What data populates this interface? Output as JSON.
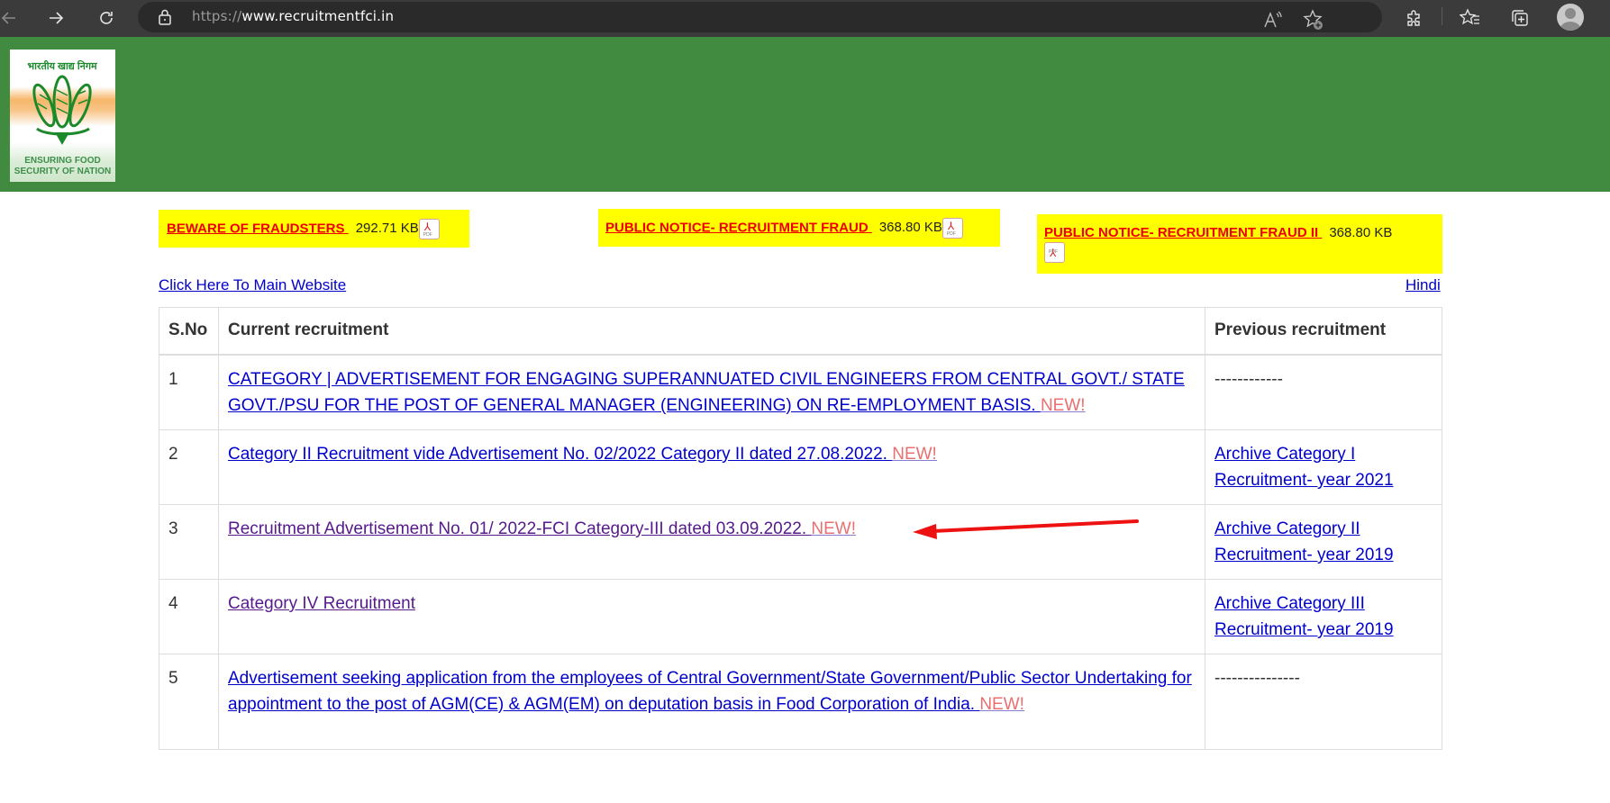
{
  "browser": {
    "url_scheme": "https://",
    "url_host": "www.recruitmentfci.in",
    "icons": [
      "back-icon",
      "forward-icon",
      "reload-icon",
      "lock-icon",
      "read-aloud-icon",
      "add-favorite-icon",
      "extensions-icon",
      "favorites-icon",
      "collections-icon",
      "profile-avatar"
    ]
  },
  "header": {
    "logo_caption_line1": "ENSURING FOOD",
    "logo_caption_line2": "SECURITY OF NATION",
    "logo_hindi": "भारतीय खाद्य निगम",
    "brand_color": "#418b41"
  },
  "notices": [
    {
      "label": "BEWARE OF FRAUDSTERS ",
      "size": "292.71 KB",
      "icon": "pdf-icon"
    },
    {
      "label": "PUBLIC NOTICE- RECRUITMENT FRAUD ",
      "size": "368.80 KB",
      "icon": "pdf-icon"
    },
    {
      "label": "PUBLIC NOTICE- RECRUITMENT FRAUD II ",
      "size": "368.80 KB",
      "icon": "pdf-icon"
    }
  ],
  "links": {
    "main_website": "Click Here To Main Website",
    "hindi": "Hindi"
  },
  "table": {
    "headers": [
      "S.No",
      "Current recruitment",
      "Previous recruitment"
    ],
    "new_label": "NEW!",
    "rows": [
      {
        "sno": "1",
        "current": "CATEGORY | ADVERTISEMENT FOR ENGAGING SUPERANNUATED CIVIL ENGINEERS FROM CENTRAL GOVT./ STATE GOVT./PSU FOR THE POST OF GENERAL MANAGER (ENGINEERING) ON RE-EMPLOYMENT BASIS.  ",
        "current_visited": false,
        "is_new": true,
        "previous": "------------",
        "previous_is_link": false
      },
      {
        "sno": "2",
        "current": "Category II Recruitment vide Advertisement No. 02/2022 Category II dated 27.08.2022.  ",
        "current_visited": false,
        "is_new": true,
        "previous": "Archive Category I Recruitment- year 2021",
        "previous_is_link": true
      },
      {
        "sno": "3",
        "current": "Recruitment Advertisement No. 01/ 2022-FCI Category-III dated 03.09.2022.   ",
        "current_visited": true,
        "is_new": true,
        "previous": "Archive Category II Recruitment- year 2019",
        "previous_is_link": true
      },
      {
        "sno": "4",
        "current": "Category IV Recruitment",
        "current_visited": true,
        "is_new": false,
        "previous": "Archive Category III Recruitment- year 2019",
        "previous_is_link": true
      },
      {
        "sno": "5",
        "current": "Advertisement seeking application from the employees of Central Government/State Government/Public Sector Undertaking for appointment to the post of AGM(CE) & AGM(EM) on deputation basis in Food Corporation of India.  ",
        "current_visited": false,
        "is_new": true,
        "previous": "---------------",
        "previous_is_link": false
      }
    ]
  },
  "annotation": {
    "type": "red-arrow",
    "points_to": "row 3 NEW! label",
    "color": "#ee1111"
  }
}
